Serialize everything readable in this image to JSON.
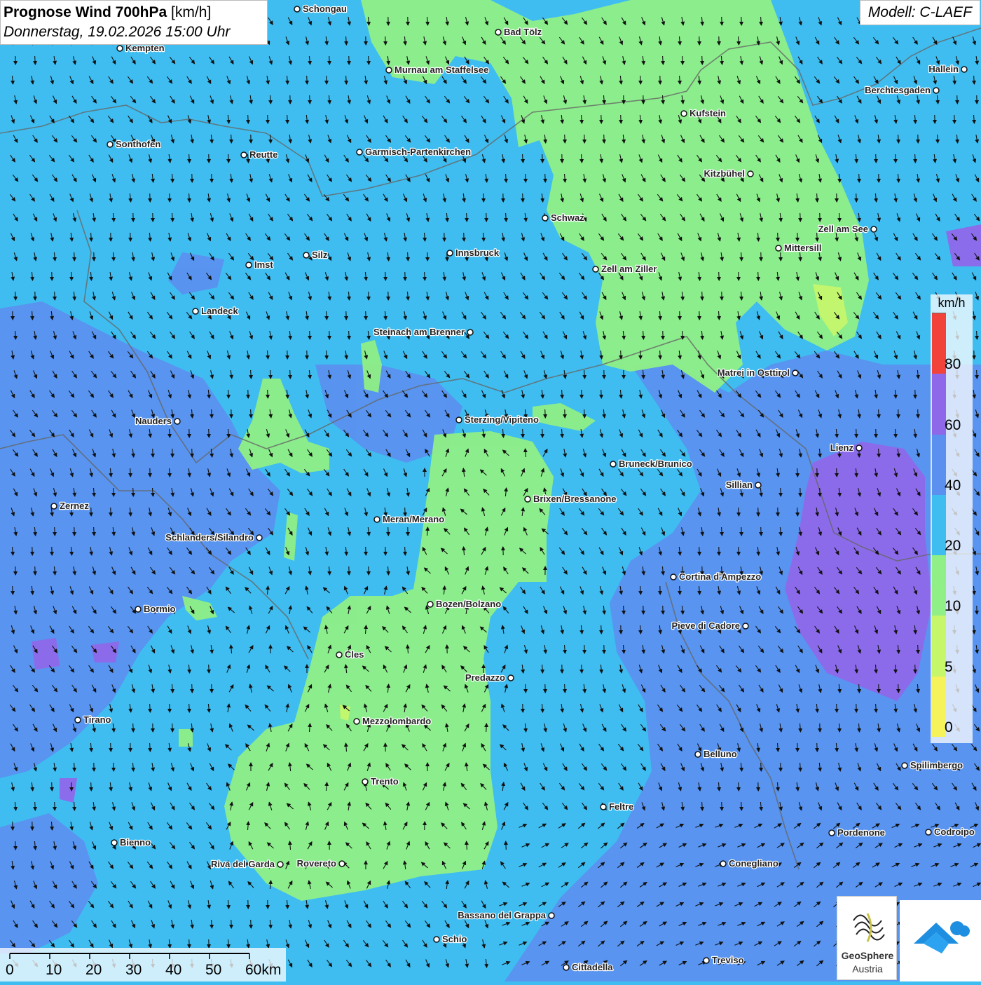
{
  "header": {
    "title_bold": "Prognose Wind 700hPa",
    "title_unit": " [km/h]",
    "datetime": "Donnerstag, 19.02.2026 15:00 Uhr",
    "model": "Modell: C-LAEF"
  },
  "legend": {
    "unit": "km/h",
    "ticks": [
      "0",
      "5",
      "10",
      "20",
      "40",
      "60",
      "80"
    ],
    "colors": [
      "#f5f25a",
      "#c6f66a",
      "#90ef86",
      "#3fbdf0",
      "#5b8ff0",
      "#8f68ea",
      "#f2433a"
    ]
  },
  "scalebar": {
    "labels": [
      "0",
      "10",
      "20",
      "30",
      "40",
      "50",
      "60km"
    ]
  },
  "logos": {
    "geosphere_name": "GeoSphere",
    "geosphere_sub": "Austria"
  },
  "colors": {
    "calm": "#90ef86",
    "moderate": "#3fbdf0",
    "strong": "#5b8ff0",
    "very_strong": "#8f68ea"
  },
  "cities": [
    {
      "name": "Schongau"
    },
    {
      "name": "Bad Tölz"
    },
    {
      "name": "Kempten"
    },
    {
      "name": "Murnau am Staffelsee"
    },
    {
      "name": "Hallein"
    },
    {
      "name": "Berchtesgaden"
    },
    {
      "name": "Kufstein"
    },
    {
      "name": "Sonthofen"
    },
    {
      "name": "Reutte"
    },
    {
      "name": "Garmisch-Partenkirchen"
    },
    {
      "name": "Kitzbühel"
    },
    {
      "name": "Schwaz"
    },
    {
      "name": "Zell am See"
    },
    {
      "name": "Mittersill"
    },
    {
      "name": "Innsbruck"
    },
    {
      "name": "Silz"
    },
    {
      "name": "Imst"
    },
    {
      "name": "Zell am Ziller"
    },
    {
      "name": "Landeck"
    },
    {
      "name": "Steinach am Brenner"
    },
    {
      "name": "Matrei in Osttirol"
    },
    {
      "name": "Nauders"
    },
    {
      "name": "Sterzing/Vipiteno"
    },
    {
      "name": "Lienz"
    },
    {
      "name": "Bruneck/Brunico"
    },
    {
      "name": "Sillian"
    },
    {
      "name": "Zernez"
    },
    {
      "name": "Brixen/Bressanone"
    },
    {
      "name": "Meran/Merano"
    },
    {
      "name": "Schlanders/Silandro"
    },
    {
      "name": "Cortina d'Ampezzo"
    },
    {
      "name": "Bozen/Bolzano"
    },
    {
      "name": "Bormio"
    },
    {
      "name": "Pieve di Cadore"
    },
    {
      "name": "Cles"
    },
    {
      "name": "Predazzo"
    },
    {
      "name": "Tirano"
    },
    {
      "name": "Mezzolombardo"
    },
    {
      "name": "Belluno"
    },
    {
      "name": "Spilimbergo"
    },
    {
      "name": "Trento"
    },
    {
      "name": "Feltre"
    },
    {
      "name": "Bienno"
    },
    {
      "name": "Pordenone"
    },
    {
      "name": "Codroipo"
    },
    {
      "name": "Riva del Garda"
    },
    {
      "name": "Rovereto"
    },
    {
      "name": "Conegliano"
    },
    {
      "name": "Bassano del Grappa"
    },
    {
      "name": "Schio"
    },
    {
      "name": "Treviso"
    },
    {
      "name": "Cittadella"
    }
  ]
}
